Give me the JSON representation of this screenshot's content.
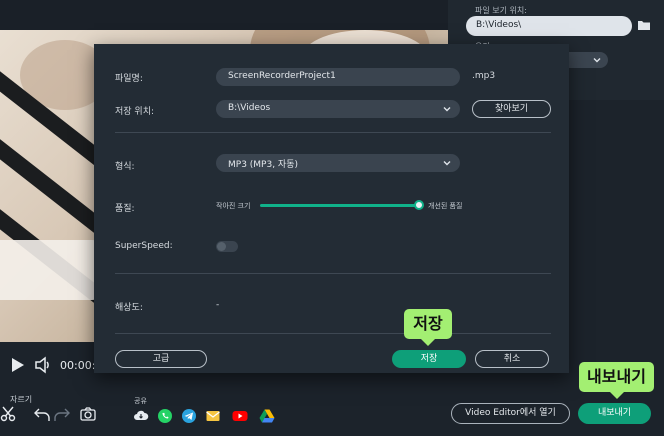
{
  "player": {
    "timecode": "00:00:",
    "cut_label": "자르기"
  },
  "side_panel": {
    "path_label": "파일 보기 위치:",
    "path_value": "B:\\Videos\\",
    "second_label": "유지:"
  },
  "share": {
    "label": "공유",
    "icons": [
      "cloud-icon",
      "whatsapp-icon",
      "telegram-icon",
      "email-icon",
      "youtube-icon",
      "google-drive-icon"
    ]
  },
  "bottom": {
    "open_editor_label": "Video Editor에서 열기",
    "export_label": "내보내기"
  },
  "dialog": {
    "filename_label": "파일명:",
    "filename_value": "ScreenRecorderProject1",
    "extension": ".mp3",
    "location_label": "저장 위치:",
    "location_value": "B:\\Videos",
    "browse_label": "찾아보기",
    "format_label": "형식:",
    "format_value": "MP3 (MP3, 자동)",
    "quality_label": "품질:",
    "quality_min": "작아진 크기",
    "quality_max": "개선된 품질",
    "quality_level": 1.0,
    "superspeed_label": "SuperSpeed:",
    "superspeed_on": false,
    "resolution_label": "해상도:",
    "resolution_value": "-",
    "advanced_label": "고급",
    "save_label": "저장",
    "cancel_label": "취소"
  },
  "callouts": {
    "save": "저장",
    "export": "내보내기"
  },
  "colors": {
    "accent": "#0e9f79",
    "callout": "#a3ef72",
    "dialog_bg": "#232c35"
  }
}
